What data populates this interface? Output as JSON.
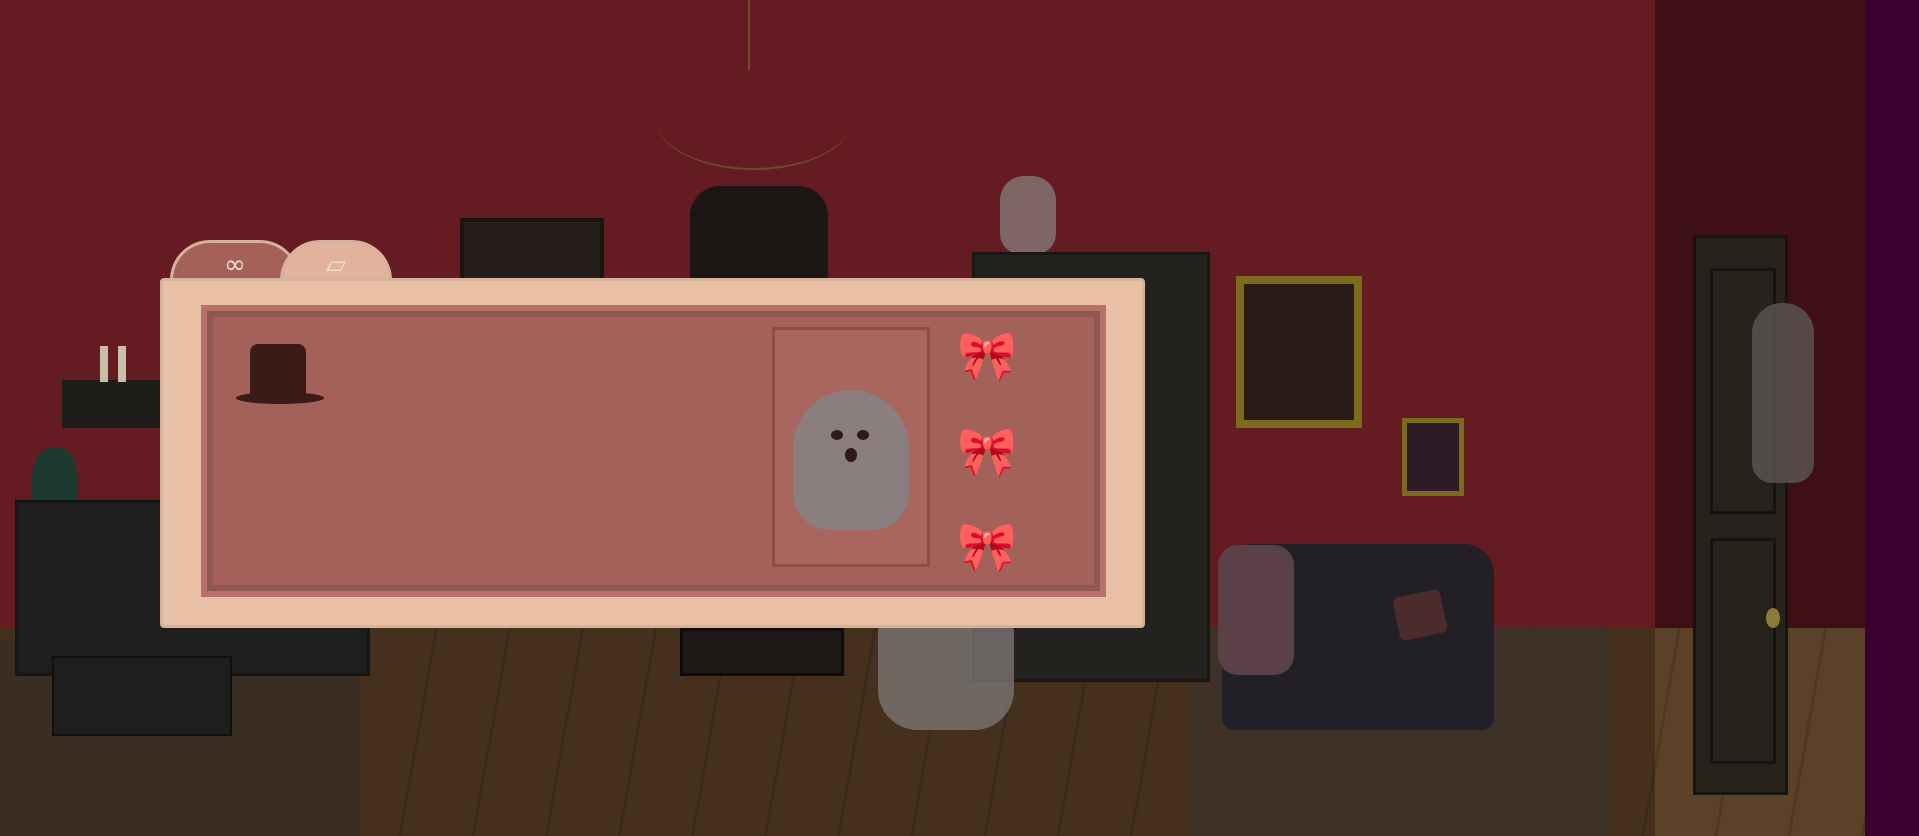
{
  "scene": {
    "room": "parlor"
  },
  "inventory": {
    "tabs": [
      {
        "icon": "spectacles-icon",
        "glyph": "∞"
      },
      {
        "icon": "cards-icon",
        "glyph": "▱"
      }
    ],
    "items": [
      {
        "icon": "top-hat-icon"
      }
    ],
    "portrait": {
      "icon": "ghost-portrait-icon"
    },
    "bows": [
      {
        "icon": "bow-icon",
        "glyph": "🎀"
      },
      {
        "icon": "bow-icon",
        "glyph": "🎀"
      },
      {
        "icon": "bow-icon",
        "glyph": "🎀"
      }
    ]
  },
  "colors": {
    "wall": "#641b22",
    "panel": "#e9bfa6",
    "panel_inner": "#a3615a",
    "accent": "#6b4a54"
  }
}
